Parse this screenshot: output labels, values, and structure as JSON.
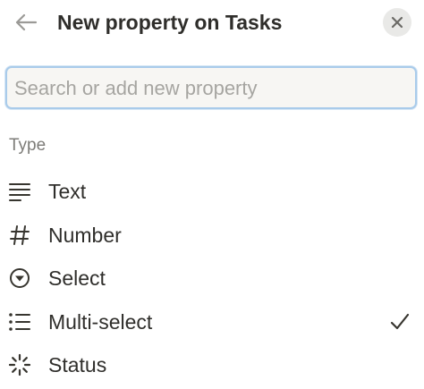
{
  "header": {
    "title": "New property on Tasks",
    "back_icon": "arrow-left-icon",
    "close_icon": "close-icon"
  },
  "search": {
    "placeholder": "Search or add new property",
    "value": ""
  },
  "section": {
    "label": "Type"
  },
  "items": [
    {
      "label": "Text",
      "icon": "text-lines-icon",
      "selected": false
    },
    {
      "label": "Number",
      "icon": "hash-icon",
      "selected": false
    },
    {
      "label": "Select",
      "icon": "select-circle-icon",
      "selected": false
    },
    {
      "label": "Multi-select",
      "icon": "bulleted-list-icon",
      "selected": true
    },
    {
      "label": "Status",
      "icon": "status-spinner-icon",
      "selected": false
    }
  ],
  "colors": {
    "text": "#2f2e2b",
    "muted": "#7d7c78",
    "placeholder": "#a6a5a1",
    "focus_border": "#a9cbea",
    "close_bg": "#e9e9e7"
  }
}
